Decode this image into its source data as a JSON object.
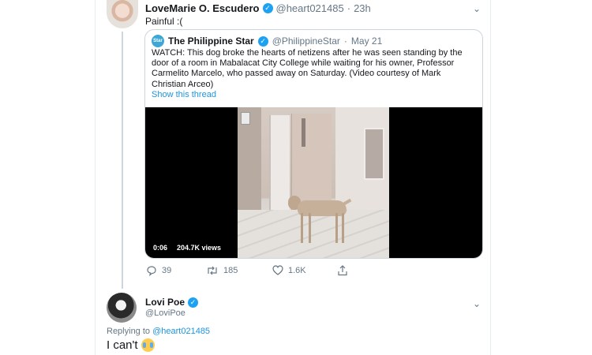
{
  "tweet1": {
    "name": "LoveMarie O. Escudero",
    "handle": "@heart021485",
    "separator": "·",
    "time": "23h",
    "text": "Painful :("
  },
  "quote": {
    "name": "The Philippine Star",
    "logo_text": "Star",
    "handle": "@PhilippineStar",
    "separator": "·",
    "date": "May 21",
    "text": "WATCH: This dog broke the hearts of netizens after he was seen standing by the door of a room in Mabalacat City College while waiting for his owner, Professor Carmelito Marcelo, who passed away on Saturday. (Video courtesy of Mark Christian Arceo)",
    "show_thread": "Show this thread",
    "video": {
      "time": "0:06",
      "views": "204.7K views"
    }
  },
  "actions": {
    "replies": "39",
    "retweets": "185",
    "likes": "1.6K"
  },
  "tweet2": {
    "name": "Lovi Poe",
    "handle": "@LoviPoe",
    "replying_prefix": "Replying to",
    "replying_to": "@heart021485",
    "text": "I can't"
  },
  "icons": {
    "verified": "verified-badge-icon",
    "reply": "reply-icon",
    "retweet": "retweet-icon",
    "like": "heart-icon",
    "share": "share-icon",
    "more": "chevron-down-icon",
    "emoji": "loudly-crying-face-icon"
  },
  "colors": {
    "link": "#1b95e0",
    "verified": "#1da1f2",
    "muted": "#657786",
    "border": "#ccd6dd"
  }
}
